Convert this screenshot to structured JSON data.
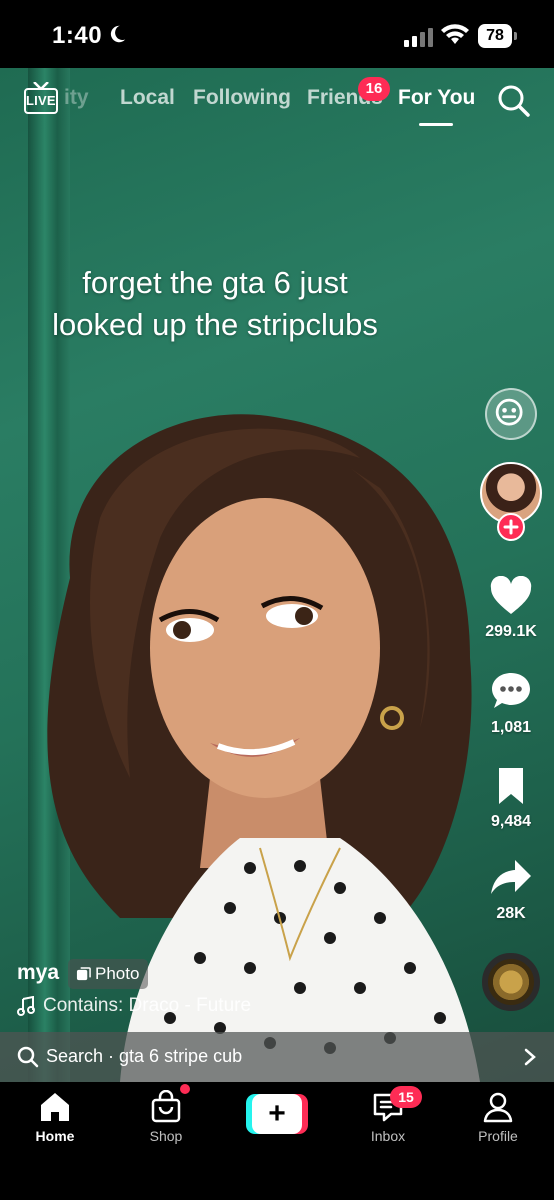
{
  "status_bar": {
    "time": "1:40",
    "battery": "78"
  },
  "top_nav": {
    "live_label": "LIVE",
    "partial_tab": "ity",
    "tabs": [
      {
        "label": "Local"
      },
      {
        "label": "Following"
      },
      {
        "label": "Friends",
        "badge": "16"
      },
      {
        "label": "For You",
        "active": true
      }
    ]
  },
  "video": {
    "caption_lines": [
      "forget the gta 6 just",
      "looked up the stripclubs"
    ],
    "username": "mya",
    "post_type": "Photo",
    "music": "Contains: Draco - Future"
  },
  "actions": {
    "likes": "299.1K",
    "comments": "1,081",
    "saves": "9,484",
    "shares": "28K"
  },
  "search_bar": {
    "text": "Search · gta 6 stripe cub"
  },
  "tab_bar": {
    "items": [
      {
        "label": "Home",
        "active": true
      },
      {
        "label": "Shop"
      },
      {
        "label": "+"
      },
      {
        "label": "Inbox",
        "badge": "15"
      },
      {
        "label": "Profile"
      }
    ]
  },
  "colors": {
    "accent_red": "#fe2c55",
    "accent_cyan": "#25f4ee",
    "background_green": "#247259"
  }
}
